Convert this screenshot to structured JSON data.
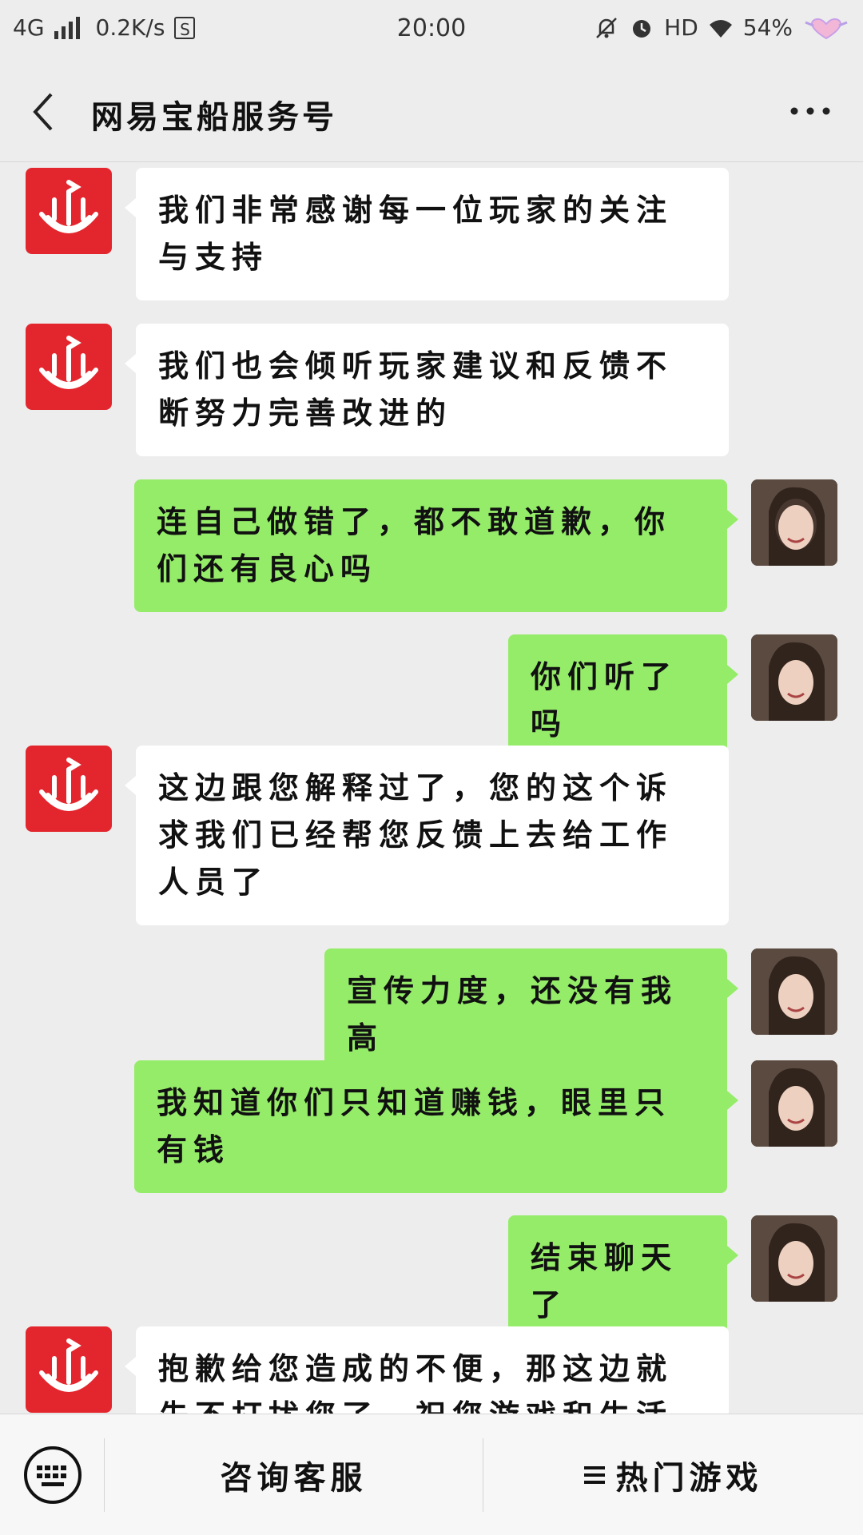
{
  "status_bar": {
    "network": "4G",
    "speed": "0.2K/s",
    "sim_badge": "S",
    "time": "20:00",
    "hd": "HD",
    "battery": "54%"
  },
  "header": {
    "title": "网易宝船服务号"
  },
  "messages": [
    {
      "side": "left",
      "text": "我们非常感谢每一位玩家的关注与支持"
    },
    {
      "side": "left",
      "text": "我们也会倾听玩家建议和反馈不断努力完善改进的"
    },
    {
      "side": "right",
      "text": "连自己做错了，都不敢道歉，你们还有良心吗"
    },
    {
      "side": "right",
      "text": "你们听了吗"
    },
    {
      "side": "left",
      "text": "这边跟您解释过了，您的这个诉求我们已经帮您反馈上去给工作人员了"
    },
    {
      "side": "right",
      "text": "宣传力度，还没有我高"
    },
    {
      "side": "right",
      "text": "我知道你们只知道赚钱，眼里只有钱"
    },
    {
      "side": "right",
      "text": "结束聊天了"
    },
    {
      "side": "left",
      "text": "抱歉给您造成的不便，那这边就先不打扰您了，祝您游戏和生活愉快"
    }
  ],
  "bottom_bar": {
    "consult_label": "咨询客服",
    "hot_games_label": "热门游戏"
  },
  "colors": {
    "background": "#ededed",
    "self_bubble": "#95ec69",
    "other_bubble": "#ffffff",
    "brand_red": "#e3262d"
  }
}
